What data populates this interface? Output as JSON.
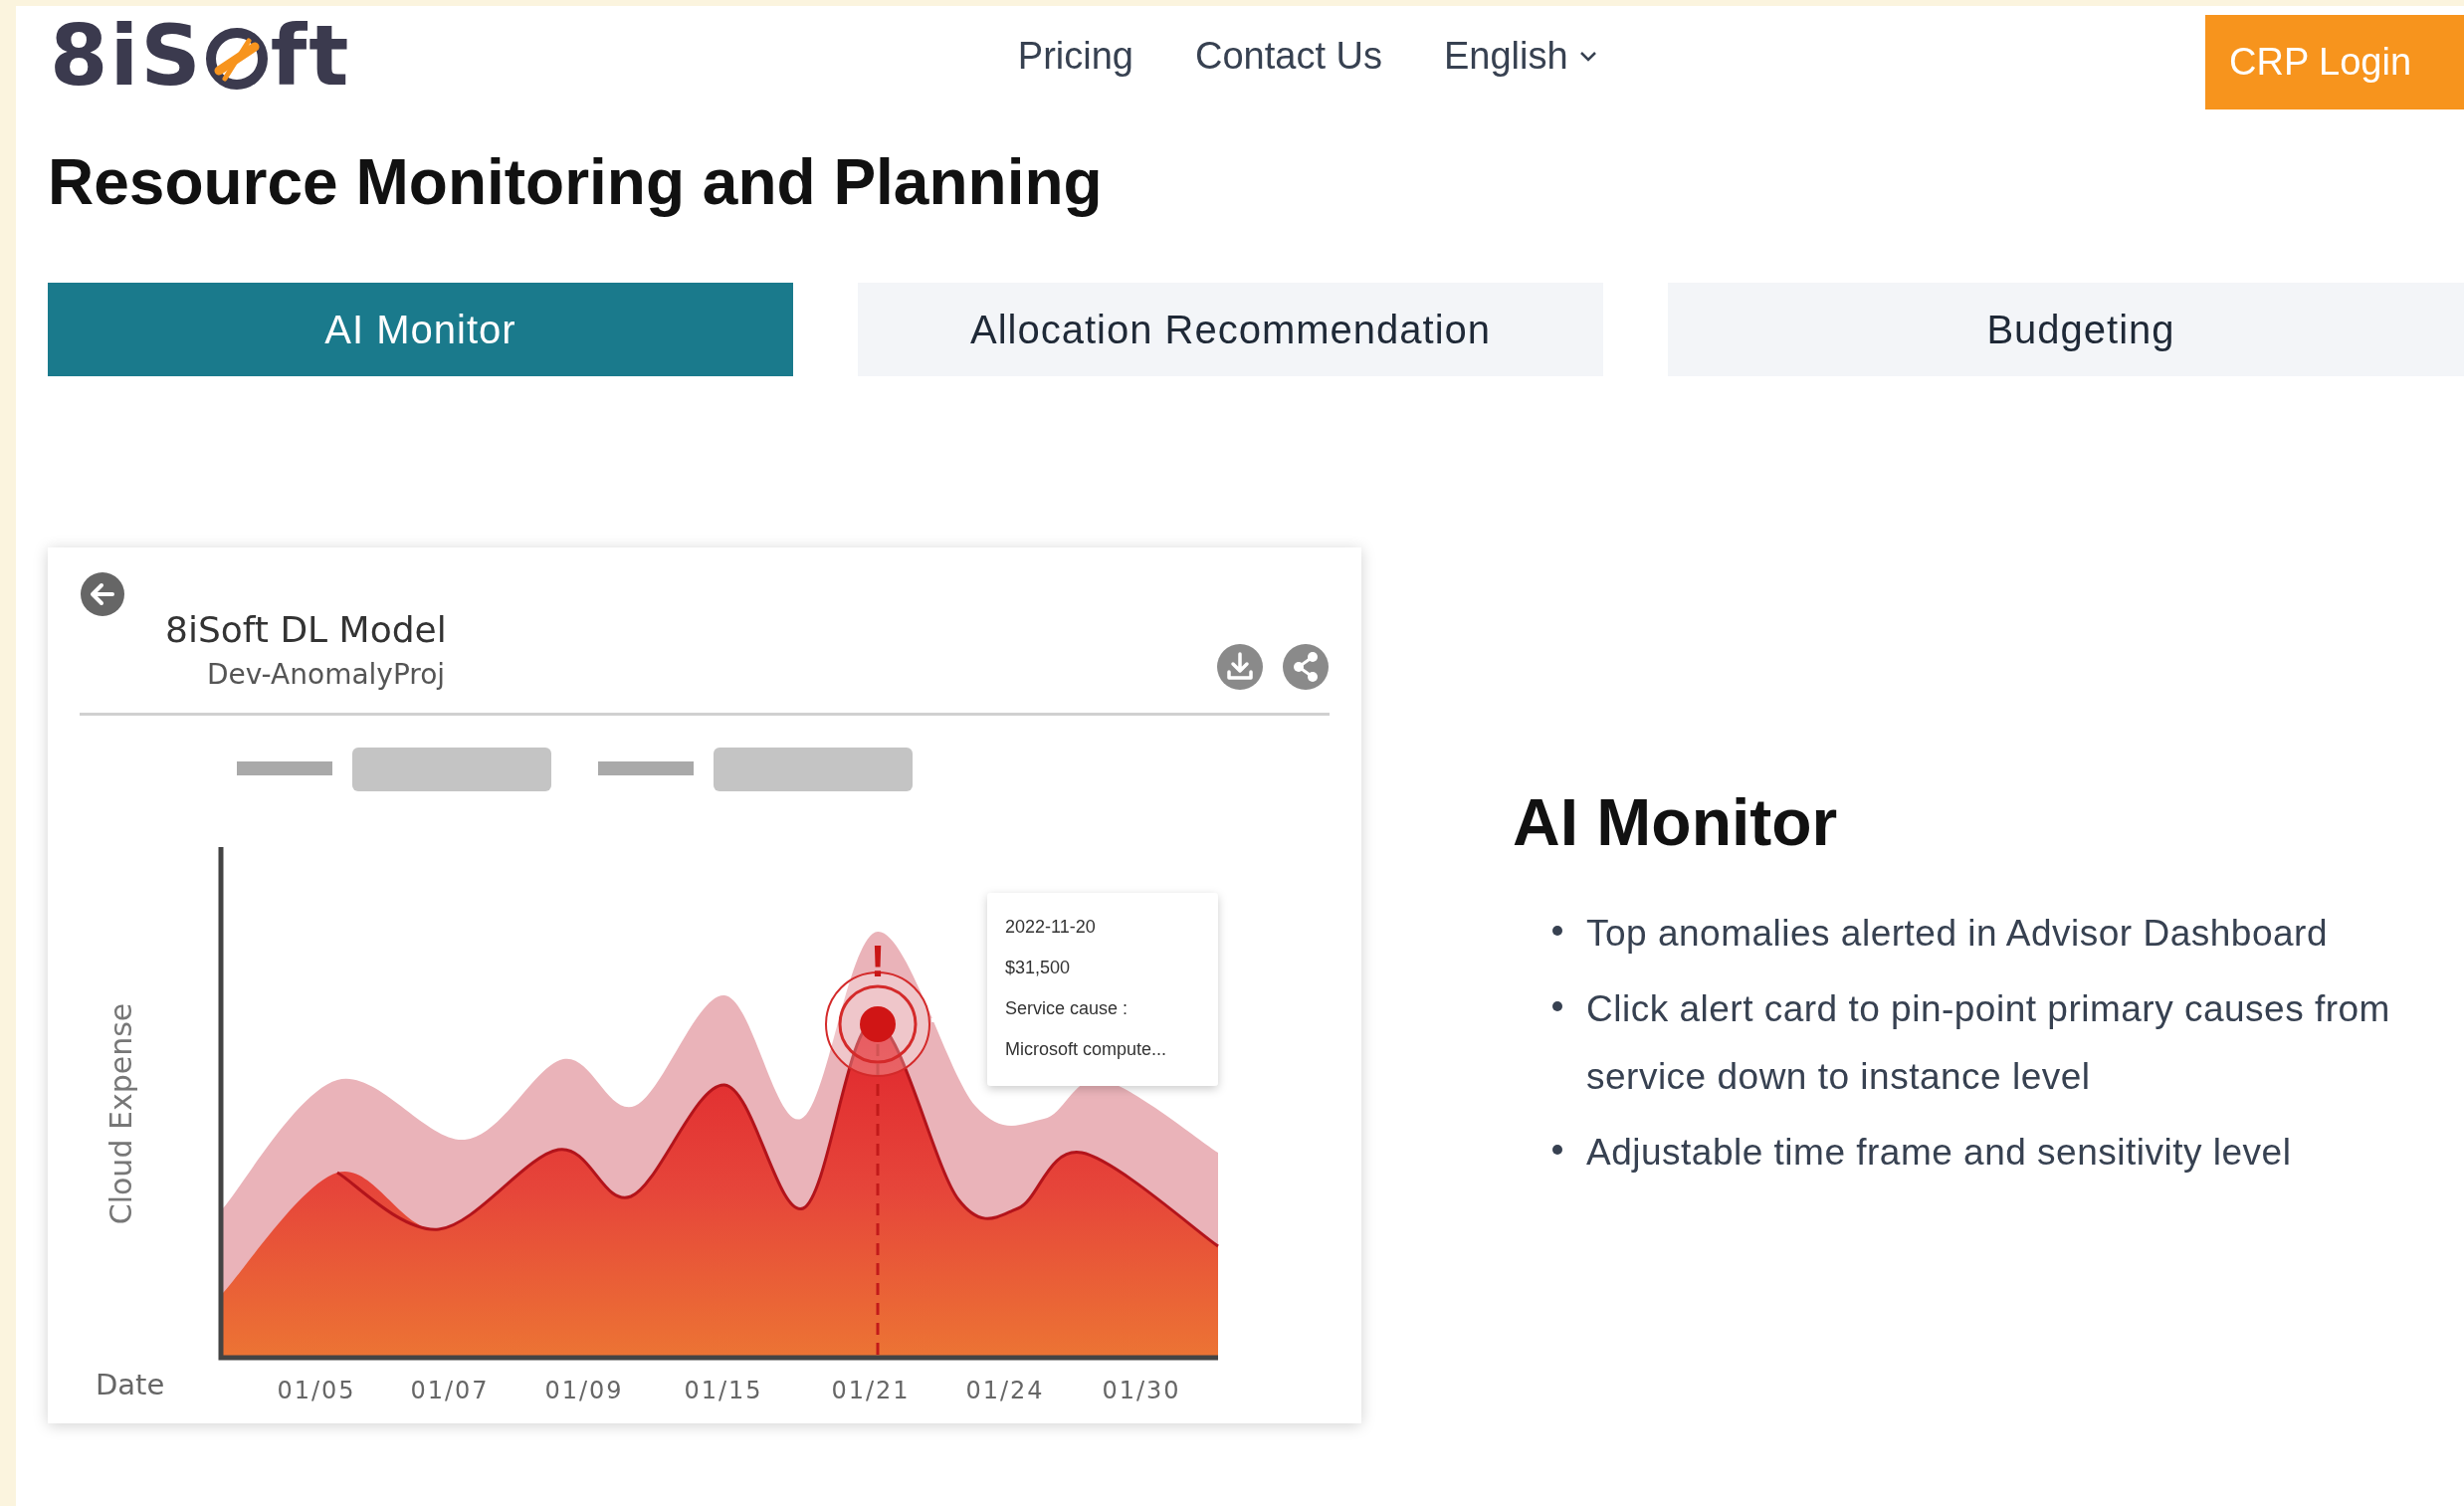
{
  "header": {
    "logo": {
      "text_before": "8iS",
      "text_after": "ft"
    },
    "nav": [
      {
        "label": "Pricing",
        "kind": "link"
      },
      {
        "label": "Contact Us",
        "kind": "link"
      },
      {
        "label": "English",
        "kind": "dropdown"
      }
    ],
    "login_button": "CRP Login"
  },
  "page_title": "Resource Monitoring and Planning",
  "tabs": [
    {
      "label": "AI Monitor",
      "selected": true
    },
    {
      "label": "Allocation Recommendation",
      "selected": false
    },
    {
      "label": "Budgeting",
      "selected": false
    }
  ],
  "preview": {
    "title": "8iSoft DL Model",
    "subtitle": "Dev-AnomalyProj",
    "y_axis_label": "Cloud Expense",
    "x_axis_label": "Date",
    "x_labels": [
      "01/05",
      "01/07",
      "01/09",
      "01/15",
      "01/21",
      "01/24",
      "01/30"
    ],
    "alert": "!",
    "tooltip": [
      "2022-11-20",
      "$31,500",
      "Service cause :",
      "Microsoft compute..."
    ]
  },
  "feature": {
    "heading": "AI Monitor",
    "bullets": [
      "Top anomalies alerted in Advisor Dashboard",
      "Click alert card to pin-point primary causes from service down to instance level",
      "Adjustable time frame and sensitivity level"
    ]
  }
}
